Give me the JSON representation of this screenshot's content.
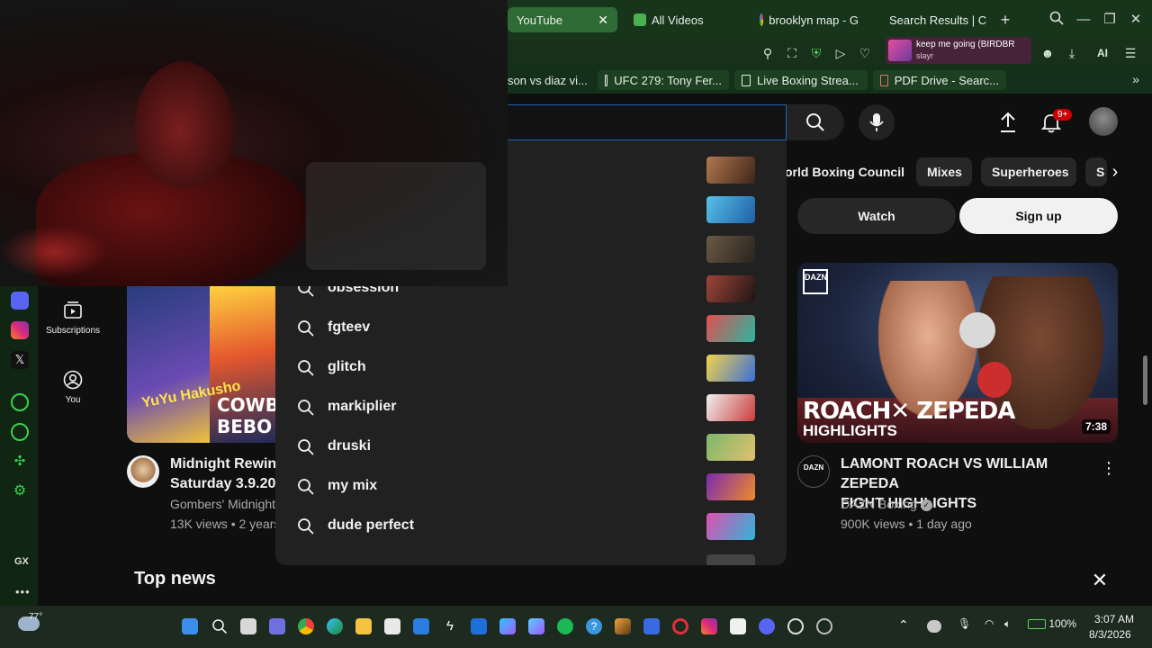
{
  "browser": {
    "tabs": [
      {
        "label": "YouTube",
        "active": true
      },
      {
        "label": "All Videos",
        "active": false
      },
      {
        "label": "brooklyn map - G",
        "active": false
      },
      {
        "label": "Search Results | C",
        "active": false
      }
    ],
    "new_tab_label": "+",
    "toolbar": {
      "ai_label": "AI",
      "media_title": "keep me going (BIRDBR",
      "media_artist": "slayr"
    },
    "bookmarks": [
      {
        "label": "son vs diaz vi..."
      },
      {
        "label": "UFC 279: Tony Fer..."
      },
      {
        "label": "Live Boxing Strea..."
      },
      {
        "label": "PDF Drive - Searc..."
      }
    ]
  },
  "opera_sidebar": {
    "gx_label": "GX",
    "more_label": "•••"
  },
  "youtube": {
    "guide": [
      {
        "label": "Subscriptions",
        "icon": "subscriptions-icon"
      },
      {
        "label": "You",
        "icon": "you-icon"
      }
    ],
    "header": {
      "notifications_badge": "9+"
    },
    "chips": [
      "orld Boxing Council",
      "Mixes",
      "Superheroes",
      "S"
    ],
    "watch_label": "Watch",
    "signup_label": "Sign up",
    "suggestions": [
      {
        "text": "obsession"
      },
      {
        "text": "fgteev"
      },
      {
        "text": "glitch"
      },
      {
        "text": "markiplier"
      },
      {
        "text": "druski"
      },
      {
        "text": "my mix"
      },
      {
        "text": "dude perfect"
      }
    ],
    "videos": [
      {
        "title_line1": "Midnight Rewind",
        "title_line2": "Saturday 3.9.20",
        "channel": "Gombers' Midnight",
        "meta": "13K views • 2 years",
        "thumb_text_1": "YuYu Hakusho",
        "thumb_text_2": "COWBO BEBO"
      },
      {
        "title_line1": "LAMONT ROACH VS WILLIAM ZEPEDA",
        "title_line2": "FIGHT HIGHLIGHTS",
        "channel": "DAZN Boxing",
        "meta": "900K views • 1 day ago",
        "duration": "7:38",
        "thumb_brand": "DAZN",
        "thumb_headline": "ROACH✕ ZEPEDA",
        "thumb_sub": "HIGHLIGHTS"
      }
    ],
    "top_news_label": "Top news"
  },
  "taskbar": {
    "temperature": "77°",
    "battery": "100%",
    "time": "3:07 AM",
    "date": "8/3/2026"
  },
  "colors": {
    "browser_bg": "#17351b",
    "youtube_bg": "#0f0f0f",
    "accent_red": "#cc0000"
  }
}
